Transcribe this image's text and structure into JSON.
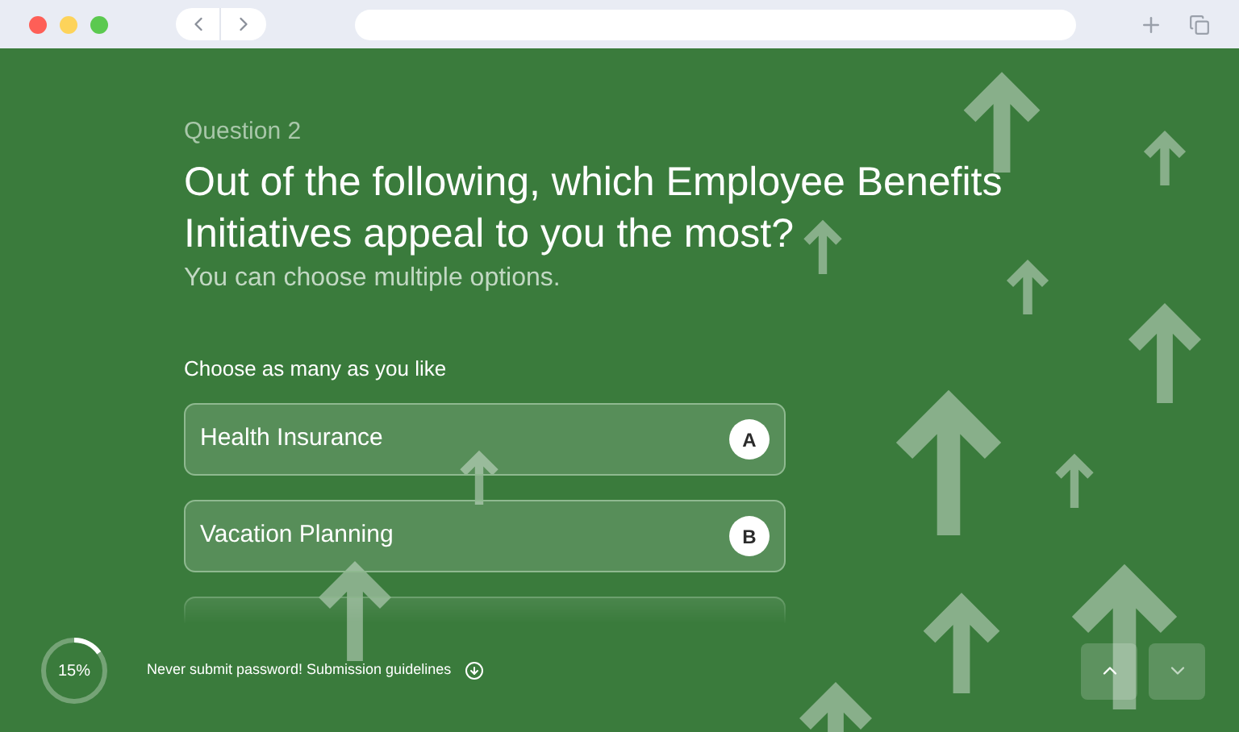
{
  "question": {
    "number": "Question 2",
    "title": "Out of the following, which Employee Benefits Initiatives appeal to you the most?",
    "subtitle": "You can choose multiple options.",
    "instruction": "Choose as many as you like"
  },
  "options": [
    {
      "label": "Health Insurance",
      "key": "A"
    },
    {
      "label": "Vacation Planning",
      "key": "B"
    }
  ],
  "progress": {
    "label": "15%",
    "level": 0.15
  },
  "footer": {
    "notice": "Never submit password! Submission guidelines"
  }
}
